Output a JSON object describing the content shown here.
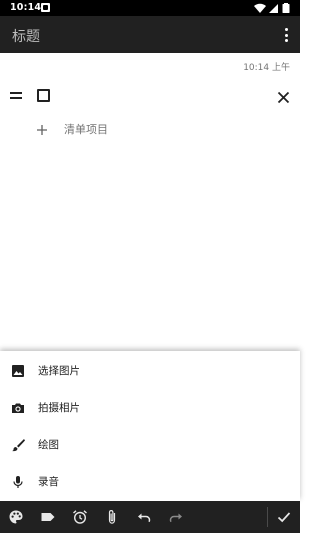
{
  "status_bar": {
    "time": "10:14"
  },
  "app_bar": {
    "title": "标题"
  },
  "note": {
    "timestamp": "10:14 上午",
    "add_item_label": "清单项目"
  },
  "attach_menu": {
    "items": [
      {
        "label": "选择图片",
        "icon": "image-icon"
      },
      {
        "label": "拍摄相片",
        "icon": "camera-icon"
      },
      {
        "label": "绘图",
        "icon": "brush-icon"
      },
      {
        "label": "录音",
        "icon": "mic-icon"
      }
    ]
  },
  "toolbar": {
    "icons": [
      "palette-icon",
      "label-icon",
      "alarm-icon",
      "attach-icon",
      "undo-icon",
      "redo-icon",
      "check-icon"
    ]
  },
  "colors": {
    "app_bar": "#212121",
    "toolbar": "#212121",
    "status_bar": "#000000"
  }
}
